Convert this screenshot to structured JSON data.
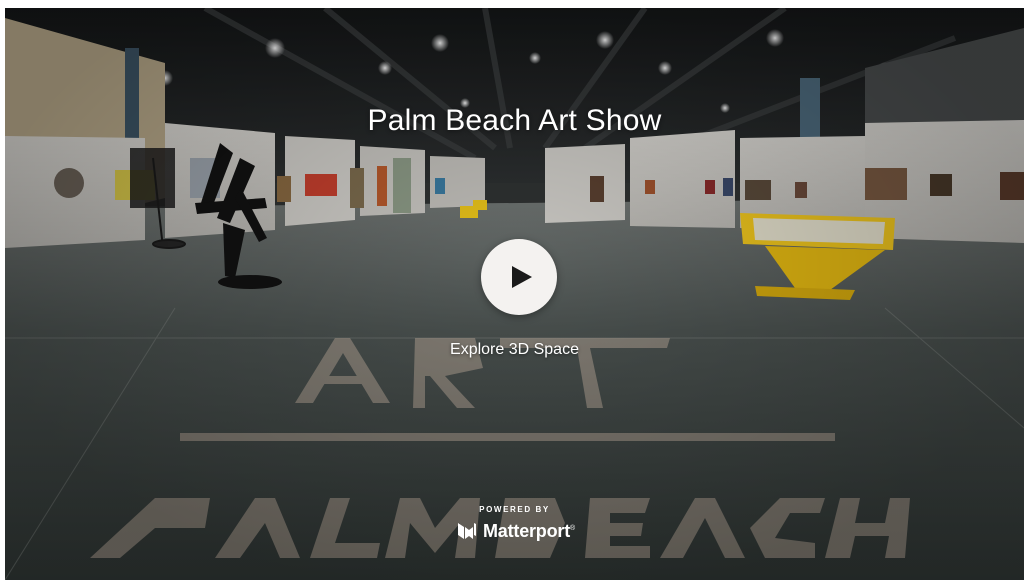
{
  "showcase": {
    "title": "Palm Beach Art Show",
    "cta_label": "Explore 3D Space",
    "powered_by": "POWERED BY",
    "brand_name": "Matterport",
    "brand_mark": "®"
  },
  "floor_text": {
    "top_word": "ART",
    "bottom_word": "PALM BEACH"
  },
  "colors": {
    "play_button_bg": "#f4f2f0",
    "play_icon": "#1a1a1a",
    "kiosk_yellow": "#f2c81e",
    "floor": "#3e4542"
  },
  "icons": {
    "play": "play-icon",
    "brand": "matterport-logo-icon"
  }
}
